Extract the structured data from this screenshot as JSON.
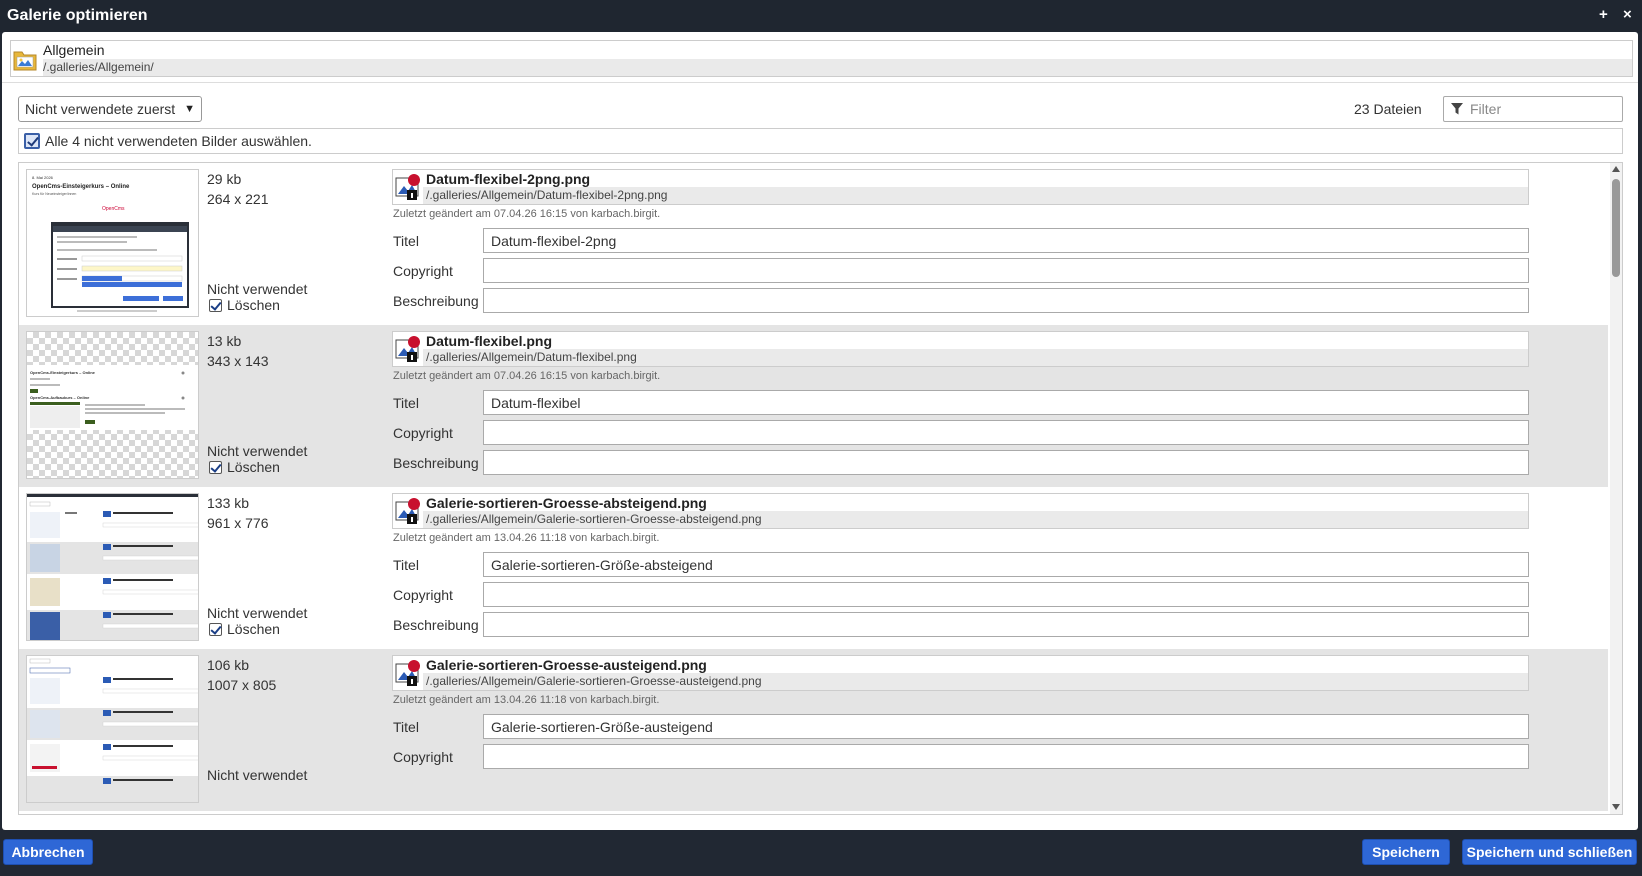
{
  "dialog": {
    "title": "Galerie optimieren",
    "maximize_icon": "+",
    "close_icon": "×"
  },
  "folder": {
    "name": "Allgemein",
    "path": "/.galleries/Allgemein/"
  },
  "toolbar": {
    "sort_selected": "Nicht verwendete zuerst",
    "file_count": "23 Dateien",
    "filter_placeholder": "Filter"
  },
  "select_all": {
    "label": "Alle 4 nicht verwendeten Bilder auswählen.",
    "checked": true
  },
  "labels": {
    "title": "Titel",
    "copyright": "Copyright",
    "description": "Beschreibung",
    "unused": "Nicht verwendet",
    "delete": "Löschen"
  },
  "files": [
    {
      "size": "29 kb",
      "dims": "264 x 221",
      "name": "Datum-flexibel-2png.png",
      "path": "/.galleries/Allgemein/Datum-flexibel-2png.png",
      "modified": "Zuletzt geändert am 07.04.26 16:15 von karbach.birgit.",
      "title_value": "Datum-flexibel-2png",
      "copyright_value": "",
      "description_value": "",
      "delete_checked": true
    },
    {
      "size": "13 kb",
      "dims": "343 x 143",
      "name": "Datum-flexibel.png",
      "path": "/.galleries/Allgemein/Datum-flexibel.png",
      "modified": "Zuletzt geändert am 07.04.26 16:15 von karbach.birgit.",
      "title_value": "Datum-flexibel",
      "copyright_value": "",
      "description_value": "",
      "delete_checked": true
    },
    {
      "size": "133 kb",
      "dims": "961 x 776",
      "name": "Galerie-sortieren-Groesse-absteigend.png",
      "path": "/.galleries/Allgemein/Galerie-sortieren-Groesse-absteigend.png",
      "modified": "Zuletzt geändert am 13.04.26 11:18 von karbach.birgit.",
      "title_value": "Galerie-sortieren-Größe-absteigend",
      "copyright_value": "",
      "description_value": "",
      "delete_checked": true
    },
    {
      "size": "106 kb",
      "dims": "1007 x 805",
      "name": "Galerie-sortieren-Groesse-austeigend.png",
      "path": "/.galleries/Allgemein/Galerie-sortieren-Groesse-austeigend.png",
      "modified": "Zuletzt geändert am 13.04.26 11:18 von karbach.birgit.",
      "title_value": "Galerie-sortieren-Größe-austeigend",
      "copyright_value": "",
      "description_value": ""
    }
  ],
  "thumbnails": {
    "t1_heading": "OpenCms-Einsteigerkurs – Online",
    "t1_date": "8. Mai 2026",
    "t1_sub": "Kurs für Neueinsteiger/innen",
    "t1_logo": "OpenCms",
    "t1_dialog_title": "Anmelden bei OpenCms",
    "t2_heading": "OpenCms-Einsteigerkurs – Online",
    "t2_heading2": "OpenCms-Aufbaukurs – Online"
  },
  "footer": {
    "cancel": "Abbrechen",
    "save": "Speichern",
    "save_close": "Speichern und schließen"
  },
  "colors": {
    "primary_button": "#2e67d6",
    "titlebar": "#1f2630",
    "row_alt": "#e4e4e4"
  }
}
